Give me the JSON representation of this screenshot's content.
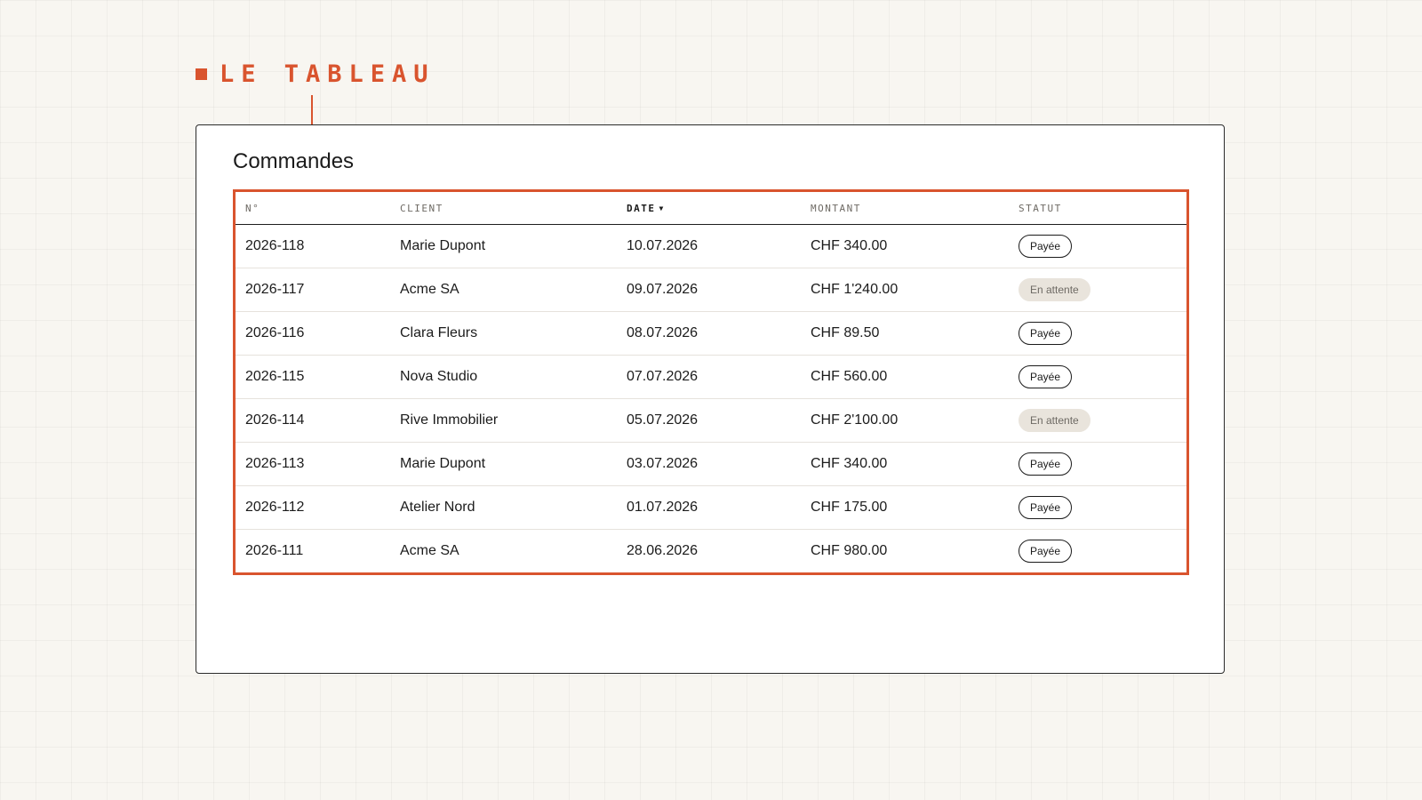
{
  "callout": {
    "label": "LE TABLEAU",
    "accent_color": "#d9542e"
  },
  "card": {
    "title": "Commandes"
  },
  "table": {
    "columns": [
      {
        "key": "num",
        "label": "N°"
      },
      {
        "key": "client",
        "label": "CLIENT"
      },
      {
        "key": "date",
        "label": "DATE",
        "sorted": "desc"
      },
      {
        "key": "amount",
        "label": "MONTANT"
      },
      {
        "key": "status",
        "label": "STATUT"
      }
    ],
    "rows": [
      {
        "num": "2026-118",
        "client": "Marie Dupont",
        "date": "10.07.2026",
        "amount": "CHF 340.00",
        "status": "Payée",
        "status_kind": "paid"
      },
      {
        "num": "2026-117",
        "client": "Acme SA",
        "date": "09.07.2026",
        "amount": "CHF 1'240.00",
        "status": "En attente",
        "status_kind": "pending"
      },
      {
        "num": "2026-116",
        "client": "Clara Fleurs",
        "date": "08.07.2026",
        "amount": "CHF 89.50",
        "status": "Payée",
        "status_kind": "paid"
      },
      {
        "num": "2026-115",
        "client": "Nova Studio",
        "date": "07.07.2026",
        "amount": "CHF 560.00",
        "status": "Payée",
        "status_kind": "paid"
      },
      {
        "num": "2026-114",
        "client": "Rive Immobilier",
        "date": "05.07.2026",
        "amount": "CHF 2'100.00",
        "status": "En attente",
        "status_kind": "pending"
      },
      {
        "num": "2026-113",
        "client": "Marie Dupont",
        "date": "03.07.2026",
        "amount": "CHF 340.00",
        "status": "Payée",
        "status_kind": "paid"
      },
      {
        "num": "2026-112",
        "client": "Atelier Nord",
        "date": "01.07.2026",
        "amount": "CHF 175.00",
        "status": "Payée",
        "status_kind": "paid"
      },
      {
        "num": "2026-111",
        "client": "Acme SA",
        "date": "28.06.2026",
        "amount": "CHF 980.00",
        "status": "Payée",
        "status_kind": "paid"
      }
    ]
  }
}
